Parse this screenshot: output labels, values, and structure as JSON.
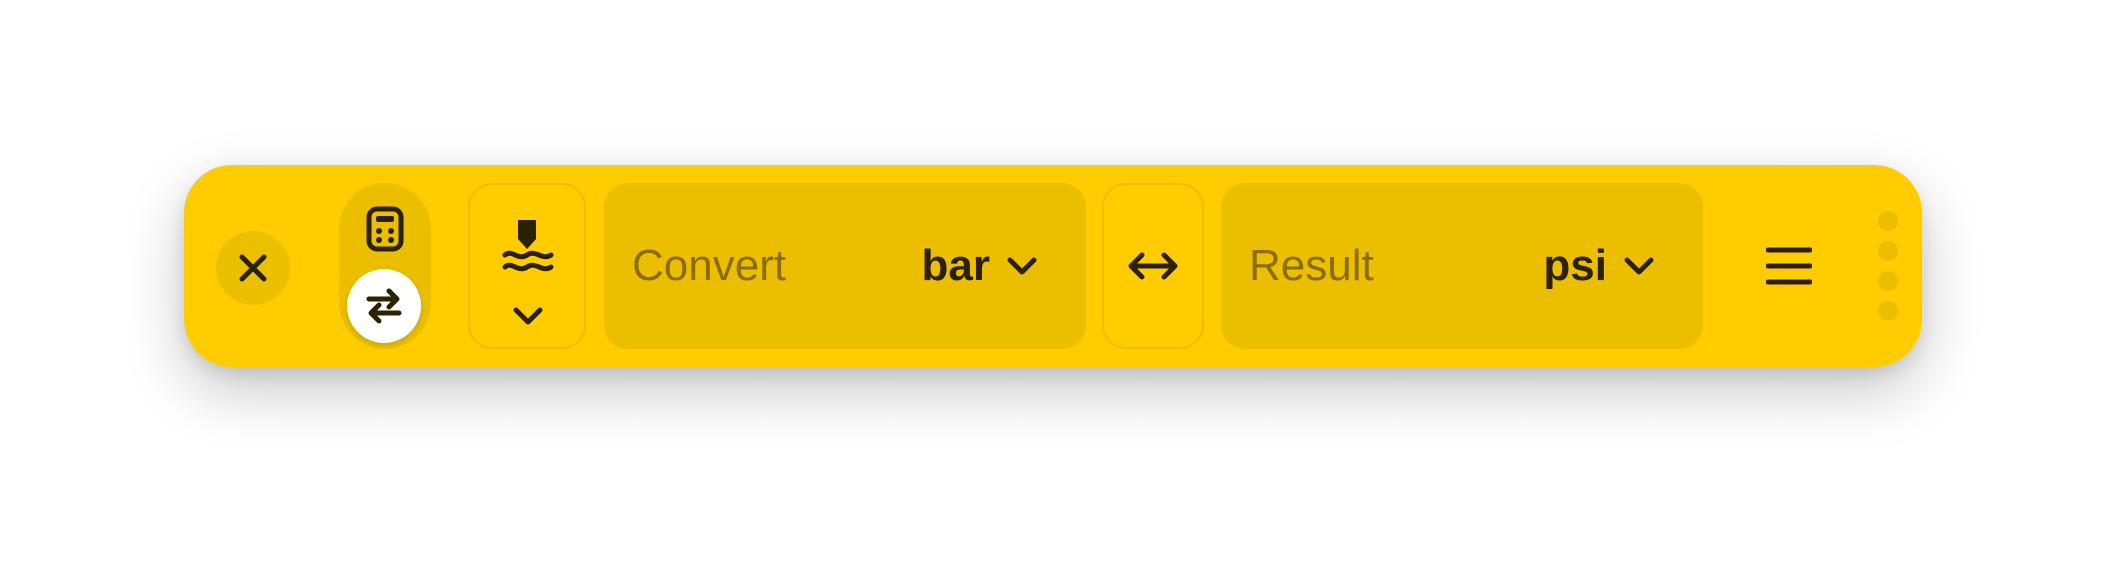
{
  "app": {
    "accent_color": "#FFCC00",
    "field_color": "#EBBF00",
    "text_color": "#2A2200",
    "placeholder_color": "#8A6C00"
  },
  "toolbar": {
    "close_icon": "close-icon",
    "mode_toggle": {
      "options": [
        {
          "name": "calculator",
          "icon": "calculator-icon"
        },
        {
          "name": "convert",
          "icon": "swap-arrows-icon"
        }
      ],
      "selected": "convert"
    },
    "category": {
      "icon": "pressure-icon",
      "chevron": "chevron-down-icon"
    },
    "convert_field": {
      "placeholder": "Convert",
      "unit": "bar"
    },
    "swap_icon": "swap-horizontal-icon",
    "result_field": {
      "placeholder": "Result",
      "unit": "psi"
    },
    "menu_icon": "hamburger-menu-icon",
    "drag_handle_icon": "drag-handle-icon"
  }
}
